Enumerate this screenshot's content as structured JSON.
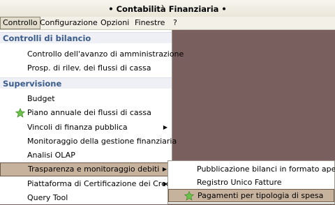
{
  "window": {
    "title": "• Contabilità Finanziaria •"
  },
  "menubar": {
    "items": [
      {
        "label": "Controllo"
      },
      {
        "label": "Configurazione"
      },
      {
        "label": "Opzioni"
      },
      {
        "label": "Finestre"
      },
      {
        "label": "?"
      }
    ]
  },
  "menu": {
    "sections": [
      {
        "label": "Controlli di bilancio"
      },
      {
        "label": "Supervisione"
      }
    ],
    "items": [
      {
        "label": "Controllo dell'avanzo di amministrazione"
      },
      {
        "label": "Prosp. di rilev. dei flussi di cassa"
      },
      {
        "label": "Budget"
      },
      {
        "label": "Piano annuale dei flussi di cassa",
        "icon": "star-icon"
      },
      {
        "label": "Vincoli di finanza pubblica",
        "submenu": true
      },
      {
        "label": "Monitoraggio della gestione finanziaria"
      },
      {
        "label": "Analisi OLAP"
      },
      {
        "label": "Trasparenza e monitoraggio debiti",
        "submenu": true,
        "highlighted": true
      },
      {
        "label": "Piattaforma di Certificazione dei Crediti",
        "submenu": true
      },
      {
        "label": "Query Tool"
      }
    ]
  },
  "submenu": {
    "items": [
      {
        "label": "Pubblicazione bilanci in formato aperto"
      },
      {
        "label": "Registro Unico Fatture"
      },
      {
        "label": "Pagamenti per tipologia di spesa",
        "icon": "star-icon",
        "highlighted": true
      }
    ]
  },
  "colors": {
    "background": "#7a5f5f",
    "highlight": "#c7b29e",
    "section_text": "#3a5c8c",
    "star": "#5dbb3a"
  }
}
